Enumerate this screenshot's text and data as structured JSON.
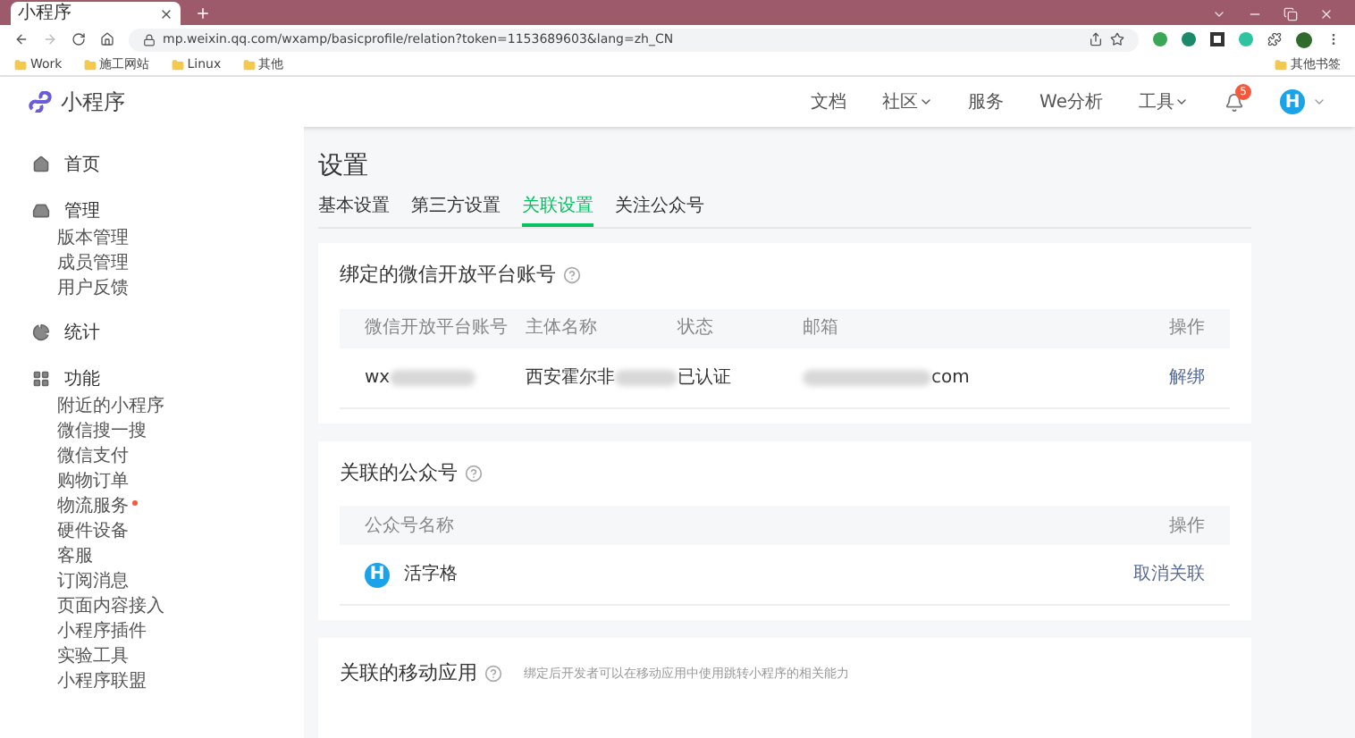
{
  "browser": {
    "tab_title": "小程序",
    "url": "mp.weixin.qq.com/wxamp/basicprofile/relation?token=1153689603&lang=zh_CN",
    "bookmarks": [
      "Work",
      "施工网站",
      "Linux",
      "其他"
    ],
    "other_bookmarks": "其他书签"
  },
  "header": {
    "logo_text": "小程序",
    "nav": [
      {
        "label": "文档",
        "has_dropdown": false
      },
      {
        "label": "社区",
        "has_dropdown": true
      },
      {
        "label": "服务",
        "has_dropdown": false
      },
      {
        "label": "We分析",
        "has_dropdown": false
      },
      {
        "label": "工具",
        "has_dropdown": true
      }
    ],
    "notification_count": "5",
    "avatar_letter": "H"
  },
  "sidebar": [
    {
      "label": "首页"
    },
    {
      "label": "管理",
      "children": [
        {
          "label": "版本管理",
          "dot": false
        },
        {
          "label": "成员管理",
          "dot": false
        },
        {
          "label": "用户反馈",
          "dot": false
        }
      ]
    },
    {
      "label": "统计"
    },
    {
      "label": "功能",
      "children": [
        {
          "label": "附近的小程序",
          "dot": false
        },
        {
          "label": "微信搜一搜",
          "dot": false
        },
        {
          "label": "微信支付",
          "dot": false
        },
        {
          "label": "购物订单",
          "dot": false
        },
        {
          "label": "物流服务",
          "dot": true
        },
        {
          "label": "硬件设备",
          "dot": false
        },
        {
          "label": "客服",
          "dot": false
        },
        {
          "label": "订阅消息",
          "dot": false
        },
        {
          "label": "页面内容接入",
          "dot": false
        },
        {
          "label": "小程序插件",
          "dot": false
        },
        {
          "label": "实验工具",
          "dot": false
        },
        {
          "label": "小程序联盟",
          "dot": false
        }
      ]
    }
  ],
  "page": {
    "title": "设置",
    "tabs": [
      {
        "label": "基本设置",
        "selected": false
      },
      {
        "label": "第三方设置",
        "selected": false
      },
      {
        "label": "关联设置",
        "selected": true
      },
      {
        "label": "关注公众号",
        "selected": false
      }
    ]
  },
  "open_platform": {
    "title": "绑定的微信开放平台账号",
    "columns": [
      "微信开放平台账号",
      "主体名称",
      "状态",
      "邮箱",
      "操作"
    ],
    "rows": [
      {
        "cells": [
          {
            "text": "wx",
            "redacted": true
          },
          {
            "text": "西安霍尔非",
            "redacted": true
          },
          {
            "text": "已认证",
            "redacted": false
          },
          {
            "text": "com",
            "redacted": true
          }
        ],
        "action": "解绑"
      }
    ]
  },
  "official_accounts": {
    "title": "关联的公众号",
    "columns": [
      "公众号名称",
      "操作"
    ],
    "rows": [
      {
        "avatar_letter": "H",
        "name": "活字格",
        "action": "取消关联"
      }
    ]
  },
  "mobile_apps": {
    "title": "关联的移动应用",
    "description": "绑定后开发者可以在移动应用中使用跳转小程序的相关能力"
  }
}
